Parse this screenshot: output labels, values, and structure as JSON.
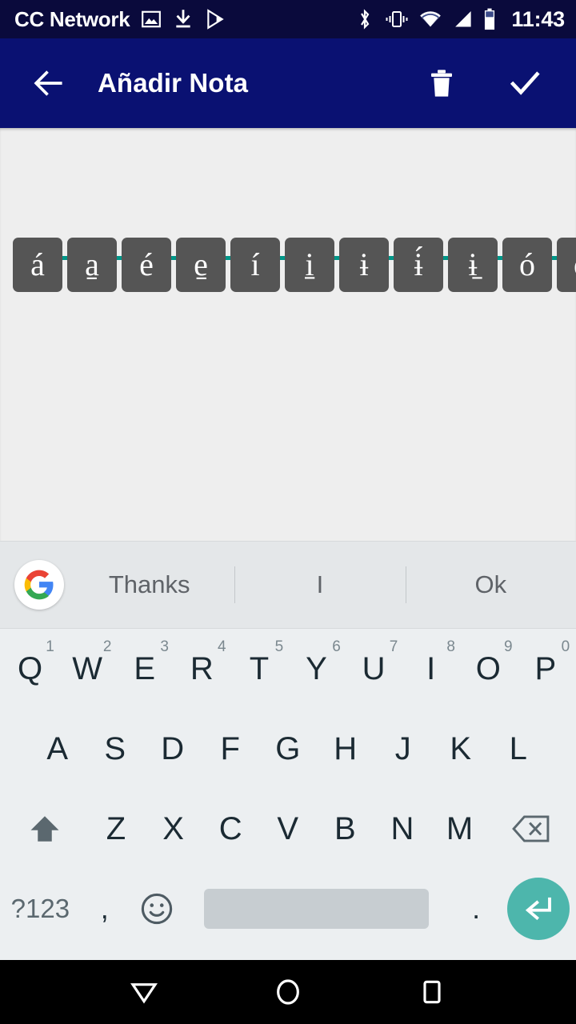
{
  "status_bar": {
    "carrier": "CC Network",
    "time": "11:43",
    "left_icons": [
      "screenshot-image-icon",
      "download-icon",
      "play-store-icon"
    ],
    "right_icons": [
      "bluetooth-icon",
      "vibrate-icon",
      "wifi-icon",
      "signal-icon",
      "battery-icon"
    ],
    "background": "#0a0a3c",
    "foreground": "#ffffff"
  },
  "app_bar": {
    "title": "Añadir Nota",
    "back_icon": "arrow-back-icon",
    "delete_label": "delete-icon",
    "confirm_label": "check-icon",
    "background": "#0a1172"
  },
  "note": {
    "value": "",
    "placeholder": "",
    "underline_color": "#009688"
  },
  "accent_strip": {
    "keys": [
      "á",
      "a̱",
      "é",
      "e̱",
      "í",
      "i̱",
      "ɨ",
      "ɨ́",
      "ɨ̱",
      "ó",
      "o"
    ],
    "key_background": "#555555",
    "key_color": "#ffffff"
  },
  "keyboard": {
    "background": "#eceff1",
    "suggestion_bar": {
      "logo": "google-g-icon",
      "suggestions": [
        "Thanks",
        "I",
        "Ok"
      ]
    },
    "row1": [
      {
        "letter": "Q",
        "num": "1"
      },
      {
        "letter": "W",
        "num": "2"
      },
      {
        "letter": "E",
        "num": "3"
      },
      {
        "letter": "R",
        "num": "4"
      },
      {
        "letter": "T",
        "num": "5"
      },
      {
        "letter": "Y",
        "num": "6"
      },
      {
        "letter": "U",
        "num": "7"
      },
      {
        "letter": "I",
        "num": "8"
      },
      {
        "letter": "O",
        "num": "9"
      },
      {
        "letter": "P",
        "num": "0"
      }
    ],
    "row2": [
      {
        "letter": "A"
      },
      {
        "letter": "S"
      },
      {
        "letter": "D"
      },
      {
        "letter": "F"
      },
      {
        "letter": "G"
      },
      {
        "letter": "H"
      },
      {
        "letter": "J"
      },
      {
        "letter": "K"
      },
      {
        "letter": "L"
      }
    ],
    "row3": [
      {
        "letter": "Z"
      },
      {
        "letter": "X"
      },
      {
        "letter": "C"
      },
      {
        "letter": "V"
      },
      {
        "letter": "B"
      },
      {
        "letter": "N"
      },
      {
        "letter": "M"
      }
    ],
    "shift_label": "shift-icon",
    "backspace_label": "backspace-icon",
    "bottom_row": {
      "symbols_label": "?123",
      "comma_label": ",",
      "emoji_label": "emoji-icon",
      "space_label": "",
      "period_label": ".",
      "enter_label": "enter-icon",
      "enter_color": "#4db6ac"
    }
  },
  "nav_bar": {
    "back": "nav-back-triangle-icon",
    "home": "nav-home-circle-icon",
    "recents": "nav-recents-square-icon",
    "background": "#000000"
  }
}
